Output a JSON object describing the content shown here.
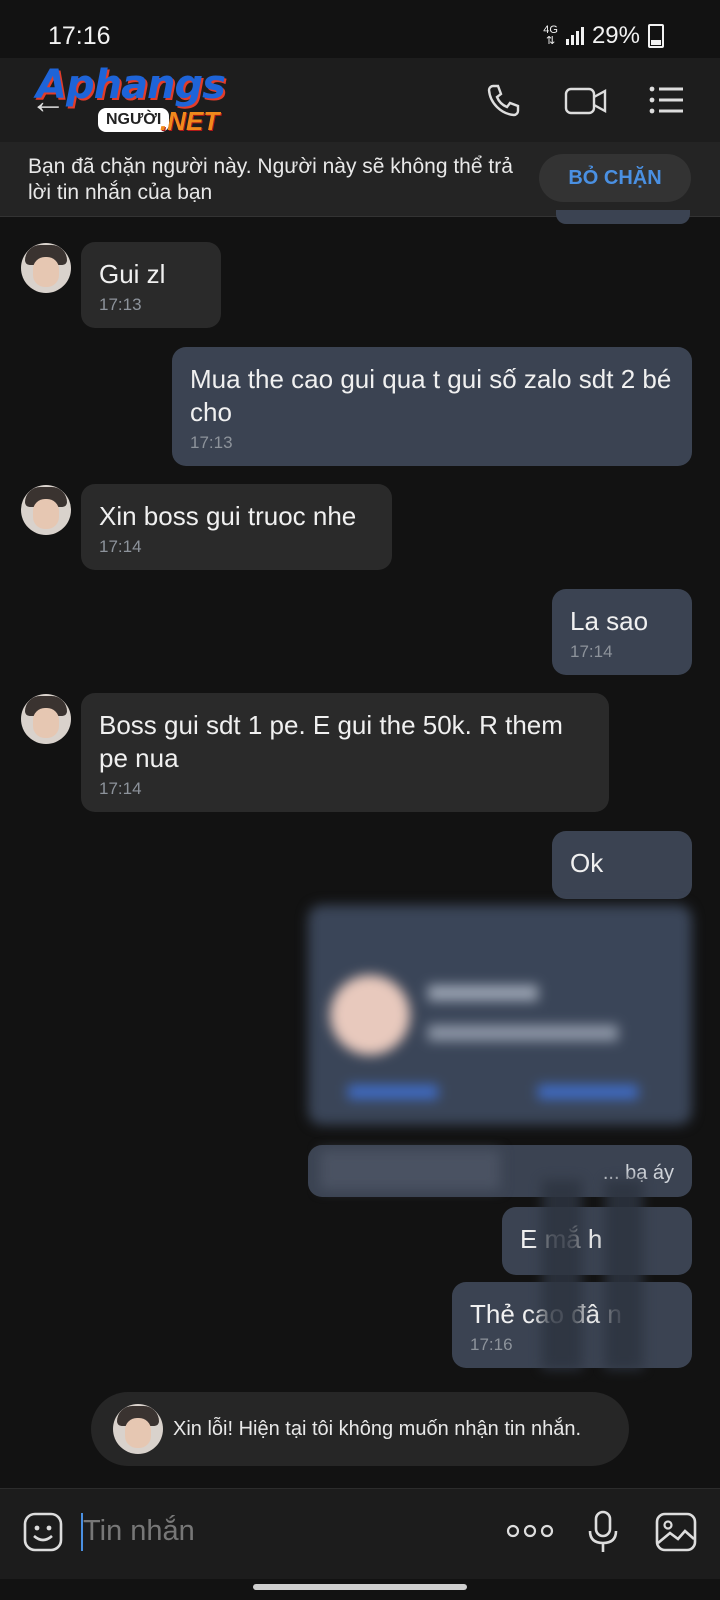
{
  "status_bar": {
    "time": "17:16",
    "network": "4G",
    "battery": "29%"
  },
  "header": {
    "logo_main": "Aphangs",
    "logo_badge": "NGƯỜI",
    "logo_net": ".NET"
  },
  "banner": {
    "text": "Bạn đã chặn người này. Người này sẽ không thể trả lời tin nhắn của bạn",
    "unblock_label": "BỎ CHẶN"
  },
  "messages": [
    {
      "dir": "in",
      "text": "Gui zl",
      "time": "17:13"
    },
    {
      "dir": "out",
      "text": "Mua the cao gui qua t gui số zalo sdt 2 bé cho",
      "time": "17:13"
    },
    {
      "dir": "in",
      "text": "Xin boss gui truoc nhe",
      "time": "17:14"
    },
    {
      "dir": "out",
      "text": "La sao",
      "time": "17:14"
    },
    {
      "dir": "in",
      "text": "Boss gui sdt 1 pe. E gui the 50k. R them pe nua",
      "time": "17:14"
    },
    {
      "dir": "out",
      "text": "Ok"
    },
    {
      "dir": "out",
      "text": "... bạ áy"
    },
    {
      "dir": "out",
      "text": "E mắ h"
    },
    {
      "dir": "out",
      "text": "Thẻ cao đâ n",
      "time": "17:16"
    }
  ],
  "notice": {
    "text": "Xin lỗi! Hiện tại tôi không muốn nhận tin nhắn."
  },
  "composer": {
    "placeholder": "Tin nhắn"
  }
}
